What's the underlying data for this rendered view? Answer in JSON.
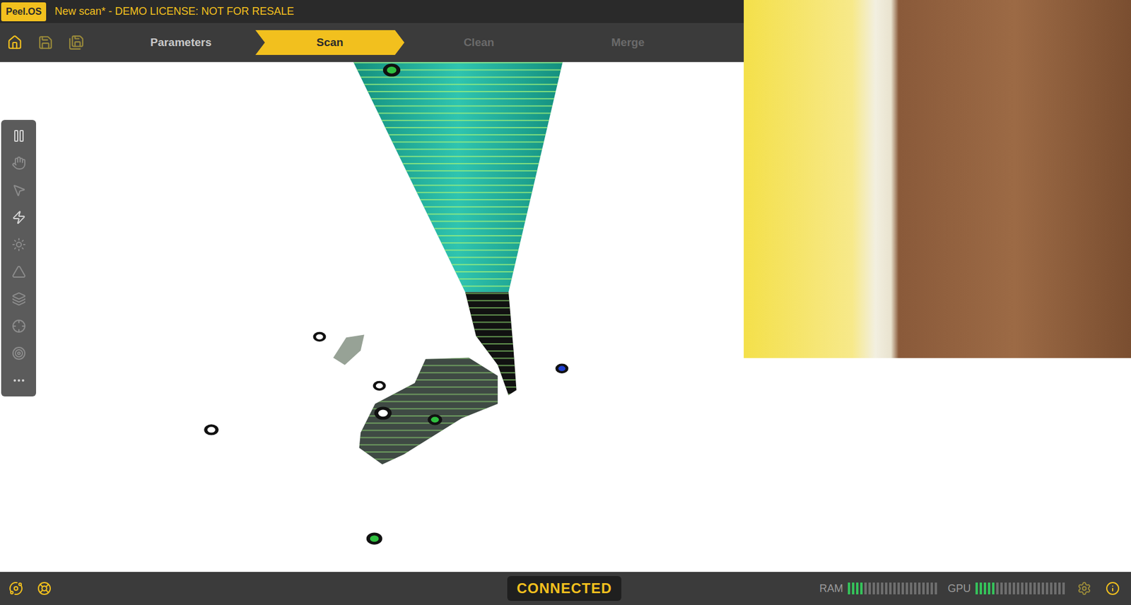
{
  "window": {
    "badge": "Peel.OS",
    "title": "New scan* - DEMO LICENSE: NOT FOR RESALE"
  },
  "tabs": [
    {
      "label": "Parameters",
      "selected": false,
      "disabled": false
    },
    {
      "label": "Scan",
      "selected": true,
      "disabled": false
    },
    {
      "label": "Clean",
      "selected": false,
      "disabled": true
    },
    {
      "label": "Merge",
      "selected": false,
      "disabled": true
    }
  ],
  "toolbar": {
    "items": [
      {
        "disabled": false
      },
      {
        "disabled": true
      },
      {
        "disabled": true
      },
      {
        "disabled": false
      },
      {
        "disabled": true
      },
      {
        "disabled": true
      },
      {
        "disabled": true
      },
      {
        "disabled": true
      },
      {
        "disabled": true
      },
      {
        "disabled": false
      }
    ]
  },
  "status_bar": {
    "connection": "CONNECTED",
    "meters": [
      {
        "label": "RAM",
        "level": 0.18
      },
      {
        "label": "GPU",
        "level": 0.23
      }
    ]
  }
}
